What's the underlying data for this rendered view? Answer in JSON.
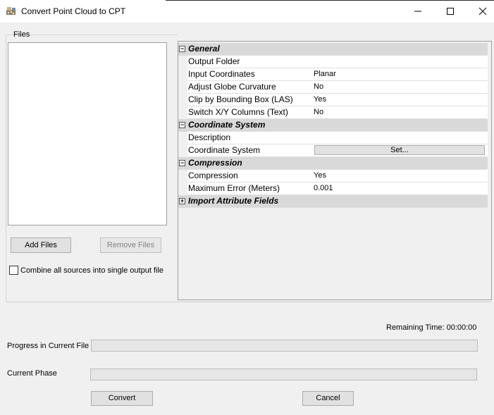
{
  "window": {
    "title": "Convert Point Cloud to CPT",
    "minimize_glyph": "—",
    "maximize_glyph": "☐",
    "close_glyph": "✕",
    "app_icon": "point-cloud-app-icon"
  },
  "files": {
    "group_label": "Files",
    "add_button": "Add Files",
    "remove_button": "Remove Files",
    "combine_checkbox_label": "Combine all sources into single output file",
    "combine_checked": false
  },
  "properties": {
    "categories": [
      {
        "name": "General",
        "expanded": true,
        "toggle": "−",
        "rows": [
          {
            "name": "Output Folder",
            "value": ""
          },
          {
            "name": "Input Coordinates",
            "value": "Planar"
          },
          {
            "name": "Adjust Globe Curvature",
            "value": "No"
          },
          {
            "name": "Clip by Bounding Box (LAS)",
            "value": "Yes"
          },
          {
            "name": "Switch X/Y Columns (Text)",
            "value": "No"
          }
        ]
      },
      {
        "name": "Coordinate System",
        "expanded": true,
        "toggle": "−",
        "rows": [
          {
            "name": "Description",
            "value": ""
          },
          {
            "name": "Coordinate System",
            "value": "",
            "button": "Set..."
          }
        ]
      },
      {
        "name": "Compression",
        "expanded": true,
        "toggle": "−",
        "rows": [
          {
            "name": "Compression",
            "value": "Yes"
          },
          {
            "name": "Maximum Error (Meters)",
            "value": "0.001"
          }
        ]
      },
      {
        "name": "Import Attribute Fields",
        "expanded": false,
        "toggle": "+",
        "rows": []
      }
    ]
  },
  "progress": {
    "remaining_time": "Remaining Time: 00:00:00",
    "current_file_label": "Progress in Current File",
    "current_file_progress": 0,
    "current_phase_label": "Current Phase",
    "current_phase_progress": 0
  },
  "actions": {
    "convert_button": "Convert",
    "cancel_button": "Cancel"
  }
}
